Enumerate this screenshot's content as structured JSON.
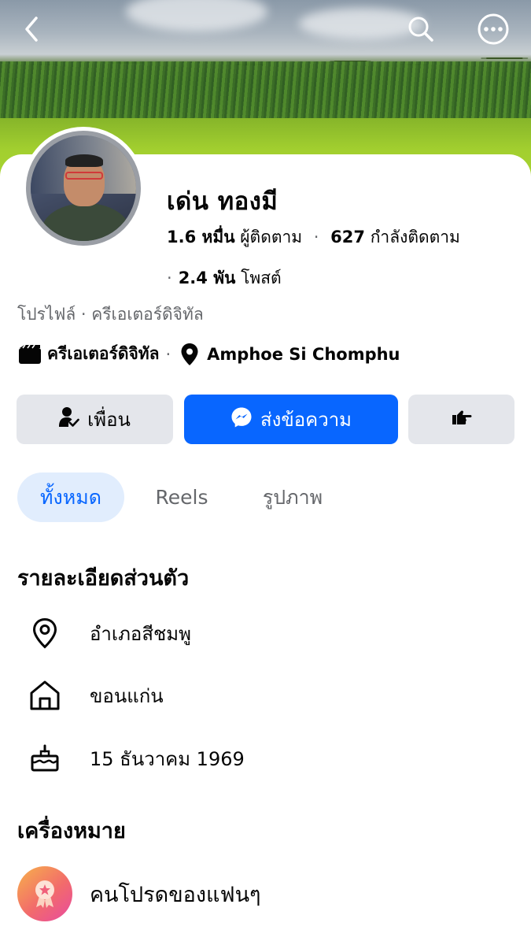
{
  "colors": {
    "accent": "#0866ff",
    "tab_active_bg": "#e1edfd",
    "button_gray": "#e4e6eb",
    "secondary_text": "#65676b"
  },
  "header": {
    "icons": [
      "back-icon",
      "search-icon",
      "more-icon"
    ]
  },
  "profile": {
    "name": "เด่น ทองมี",
    "followers_count": "1.6 หมื่น",
    "followers_label": "ผู้ติดตาม",
    "following_count": "627",
    "following_label": "กำลังติดตาม",
    "posts_count": "2.4 พัน",
    "posts_label": "โพสต์",
    "subtitle": "โปรไฟล์ · ครีเอเตอร์ดิจิทัล",
    "category": "ครีเอเตอร์ดิจิทัล",
    "location": "Amphoe Si Chomphu"
  },
  "actions": {
    "friends_label": "เพื่อน",
    "message_label": "ส่งข้อความ"
  },
  "tabs": [
    {
      "label": "ทั้งหมด",
      "active": true
    },
    {
      "label": "Reels",
      "active": false
    },
    {
      "label": "รูปภาพ",
      "active": false
    }
  ],
  "details": {
    "title": "รายละเอียดส่วนตัว",
    "current_city": "อำเภอสีชมพู",
    "hometown": "ขอนแก่น",
    "birthday": "15 ธันวาคม  1969"
  },
  "badges": {
    "title": "เครื่องหมาย",
    "items": [
      {
        "label": "คนโปรดของแฟนๆ"
      }
    ]
  }
}
